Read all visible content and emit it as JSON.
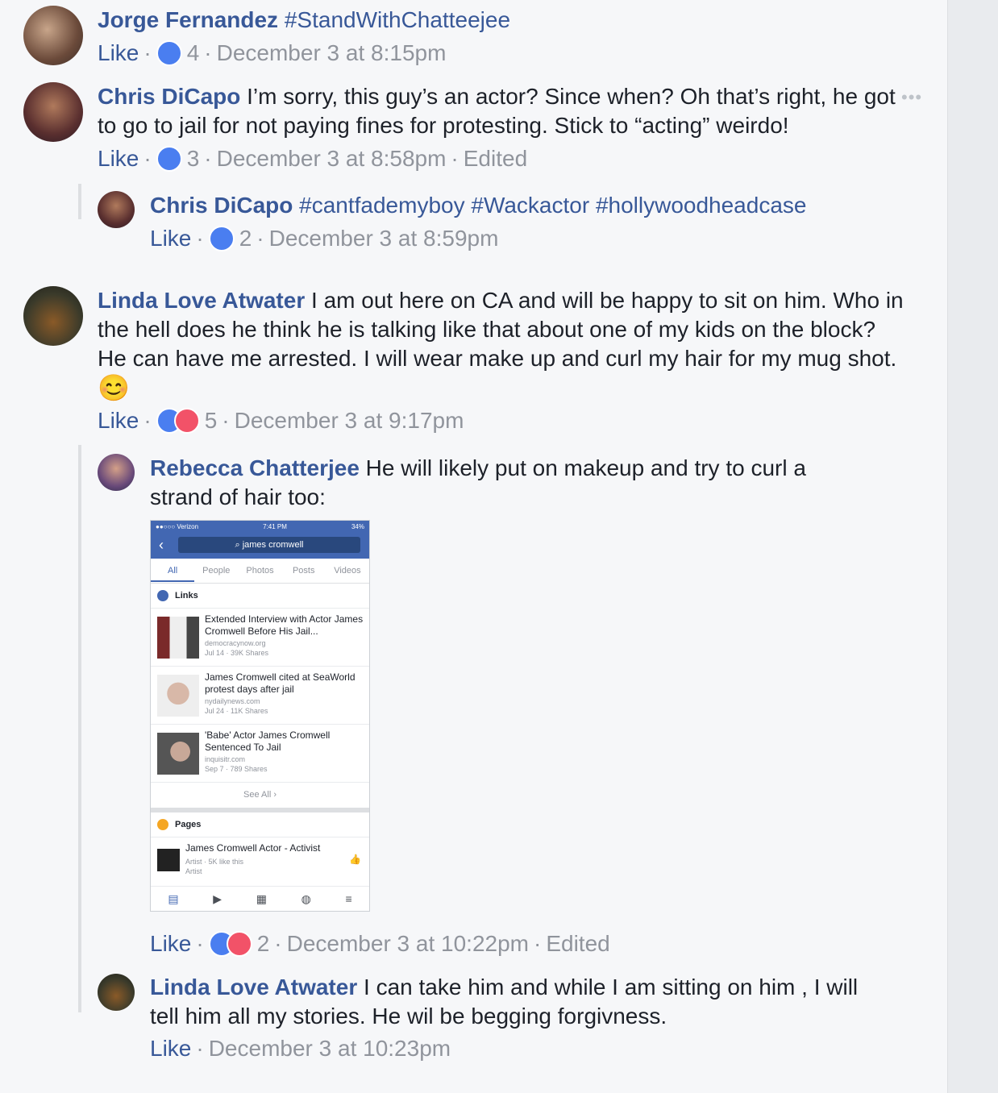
{
  "comments": [
    {
      "name": "Jorge Fernandez",
      "text": " #StandWithChatteejee",
      "like": "Like",
      "count": "4",
      "time": "December 3 at 8:15pm",
      "edited": ""
    },
    {
      "name": "Chris DiCapo",
      "text": " I’m sorry, this guy’s an actor? Since when? Oh that’s right, he got to go to jail for not paying fines for protesting. Stick to “acting” weirdo!",
      "like": "Like",
      "count": "3",
      "time": "December 3 at 8:58pm",
      "edited": "Edited"
    },
    {
      "name": "Chris DiCapo",
      "text": " #cantfademyboy #Wackactor #hollywoodheadcase",
      "like": "Like",
      "count": "2",
      "time": "December 3 at 8:59pm",
      "edited": ""
    },
    {
      "name": "Linda Love Atwater",
      "text": " I am out here on CA and will be happy to sit on him. Who in the hell does he think he is talking like that about one of my kids on the block? He can have me arrested. I will wear make up and curl my hair for my mug shot. ",
      "emoji": "😊",
      "like": "Like",
      "count": "5",
      "time": "December 3 at 9:17pm",
      "edited": ""
    },
    {
      "name": "Rebecca Chatterjee",
      "text": " He will likely put on makeup and try to curl a strand of hair too:",
      "like": "Like",
      "count": "2",
      "time": "December 3 at 10:22pm",
      "edited": "Edited"
    },
    {
      "name": "Linda Love Atwater",
      "text": " I can take him and while I am sitting on him , I will tell him all my stories. He wil be begging forgivness.",
      "like": "Like",
      "count": "",
      "time": "December 3 at 10:23pm",
      "edited": ""
    }
  ],
  "embed": {
    "carrier": "●●○○○ Verizon",
    "clock": "7:41 PM",
    "battery": "34%",
    "search": "james cromwell",
    "tabs": [
      "All",
      "People",
      "Photos",
      "Posts",
      "Videos"
    ],
    "links_header": "Links",
    "links": [
      {
        "title": "Extended Interview with Actor James Cromwell Before His Jail...",
        "source": "democracynow.org",
        "stats": "Jul 14 · 39K Shares"
      },
      {
        "title": "James Cromwell cited at SeaWorld protest days after jail",
        "source": "nydailynews.com",
        "stats": "Jul 24 · 11K Shares"
      },
      {
        "title": "'Babe' Actor James Cromwell Sentenced To Jail",
        "source": "inquisitr.com",
        "stats": "Sep 7 · 789 Shares"
      }
    ],
    "see_all": "See All ›",
    "pages_header": "Pages",
    "page": {
      "title": "James Cromwell Actor - Activist",
      "sub": "Artist · 5K like this",
      "cat": "Artist"
    }
  },
  "colors": {
    "link": "#385898",
    "meta": "#90949c",
    "like_blue": "#4a7ef0",
    "love_red": "#f25268",
    "bg": "#f6f7f9"
  }
}
